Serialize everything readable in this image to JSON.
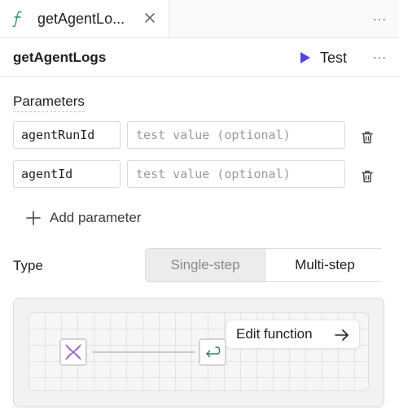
{
  "tab": {
    "title": "getAgentLo...",
    "icon": "function-icon"
  },
  "header": {
    "title": "getAgentLogs",
    "test_label": "Test",
    "more": "···"
  },
  "tabbar_more": "···",
  "parameters": {
    "title": "Parameters",
    "items": [
      {
        "name": "agentRunId",
        "placeholder": "test value (optional)"
      },
      {
        "name": "agentId",
        "placeholder": "test value (optional)"
      }
    ],
    "add_label": "Add parameter"
  },
  "type": {
    "label": "Type",
    "options": [
      "Single-step",
      "Multi-step"
    ],
    "selected": "Multi-step"
  },
  "flow": {
    "edit_label": "Edit function",
    "nodes": [
      "agent-node-icon",
      "return-node-icon"
    ]
  },
  "colors": {
    "accent": "#4f46e5",
    "function_icon": "#3d8f78",
    "return_icon": "#2f7d5c",
    "agent_icon": "#b06ad0"
  }
}
